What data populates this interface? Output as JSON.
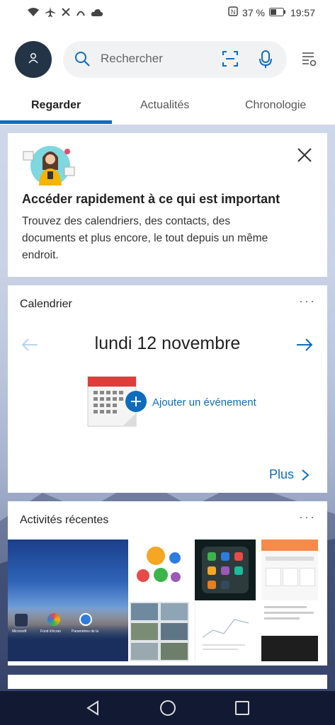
{
  "status_bar": {
    "battery_percent": "37 %",
    "time": "19:57",
    "icons": [
      "wifi-icon",
      "airplane-icon",
      "data-saver-icon",
      "hotspot-icon",
      "cloud-icon",
      "nfc-icon",
      "battery-icon"
    ]
  },
  "header": {
    "avatar_icon": "person-icon",
    "search_placeholder": "Rechercher",
    "search_icon": "search-icon",
    "scan_icon": "scan-icon",
    "mic_icon": "microphone-icon",
    "settings_icon": "settings-list-icon"
  },
  "tabs": [
    {
      "label": "Regarder",
      "active": true
    },
    {
      "label": "Actualités",
      "active": false
    },
    {
      "label": "Chronologie",
      "active": false
    }
  ],
  "hero_card": {
    "title": "Accéder rapidement à ce qui est important",
    "text": "Trouvez des calendriers, des contacts, des documents et plus encore, le tout depuis un même endroit.",
    "close_icon": "close-icon"
  },
  "calendar_card": {
    "title": "Calendrier",
    "more_label": "···",
    "date": "lundi 12 novembre",
    "add_event": "Ajouter un événement",
    "more_link": "Plus"
  },
  "recent_card": {
    "title": "Activités récentes",
    "more_label": "···",
    "thumb_captions": [
      "Microsoft",
      "Fond d'écran",
      "Paramètres de la"
    ]
  },
  "nav_bar": {
    "icons": [
      "back-icon",
      "home-icon",
      "recents-icon"
    ]
  },
  "colors": {
    "accent": "#0f6cbd",
    "avatar_bg": "#243447",
    "nav_bg": "#121a33"
  }
}
